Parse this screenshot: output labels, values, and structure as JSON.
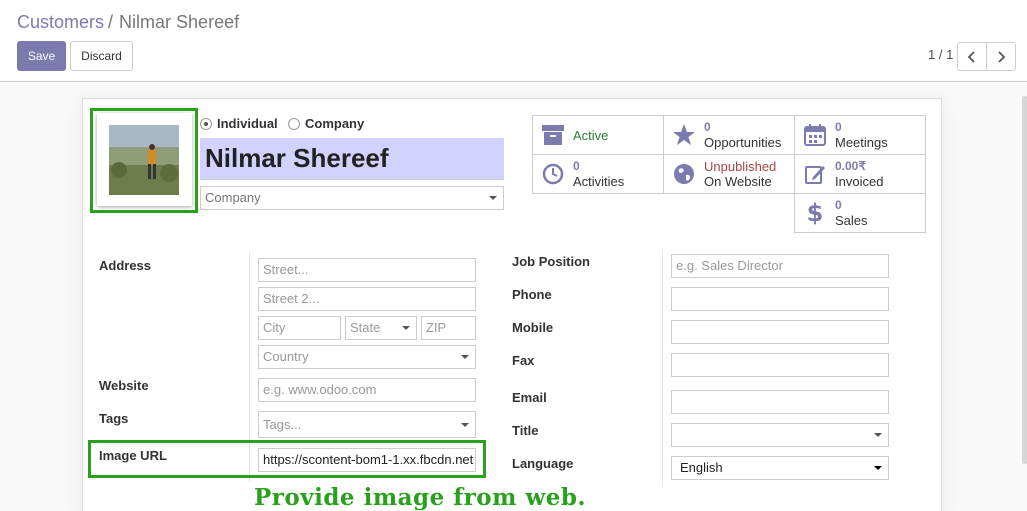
{
  "breadcrumb": {
    "parent": "Customers",
    "separator": "/",
    "current": "Nilmar Shereef"
  },
  "buttons": {
    "save": "Save",
    "discard": "Discard"
  },
  "pager": {
    "value": "1 / 1"
  },
  "partner_type": {
    "individual": "Individual",
    "company": "Company",
    "selected": "individual"
  },
  "name": "Nilmar Shereef",
  "company_placeholder": "Company",
  "stats": {
    "active": {
      "label": "Active",
      "icon": "archive-icon"
    },
    "opportunities": {
      "count": "0",
      "label": "Opportunities",
      "icon": "star-icon"
    },
    "meetings": {
      "count": "0",
      "label": "Meetings",
      "icon": "calendar-icon"
    },
    "activities": {
      "count": "0",
      "label": "Activities",
      "icon": "clock-icon"
    },
    "website": {
      "status": "Unpublished",
      "label": "On Website",
      "icon": "globe-icon"
    },
    "invoiced": {
      "count": "0.00₹",
      "label": "Invoiced",
      "icon": "edit-icon"
    },
    "sales": {
      "count": "0",
      "label": "Sales",
      "icon": "dollar-icon"
    }
  },
  "labels": {
    "address": "Address",
    "website": "Website",
    "tags": "Tags",
    "image_url": "Image URL",
    "job_position": "Job Position",
    "phone": "Phone",
    "mobile": "Mobile",
    "fax": "Fax",
    "email": "Email",
    "title": "Title",
    "language": "Language"
  },
  "placeholders": {
    "street": "Street...",
    "street2": "Street 2...",
    "city": "City",
    "state": "State",
    "zip": "ZIP",
    "country": "Country",
    "website": "e.g. www.odoo.com",
    "tags": "Tags...",
    "job_position": "e.g. Sales Director"
  },
  "values": {
    "image_url": "https://scontent-bom1-1.xx.fbcdn.net",
    "language": "English"
  },
  "caption": "Provide image from web.",
  "colors": {
    "brand": "#7c7bad",
    "highlight": "#2aa11c",
    "active": "#2e7d32",
    "unpublished": "#a94442"
  }
}
